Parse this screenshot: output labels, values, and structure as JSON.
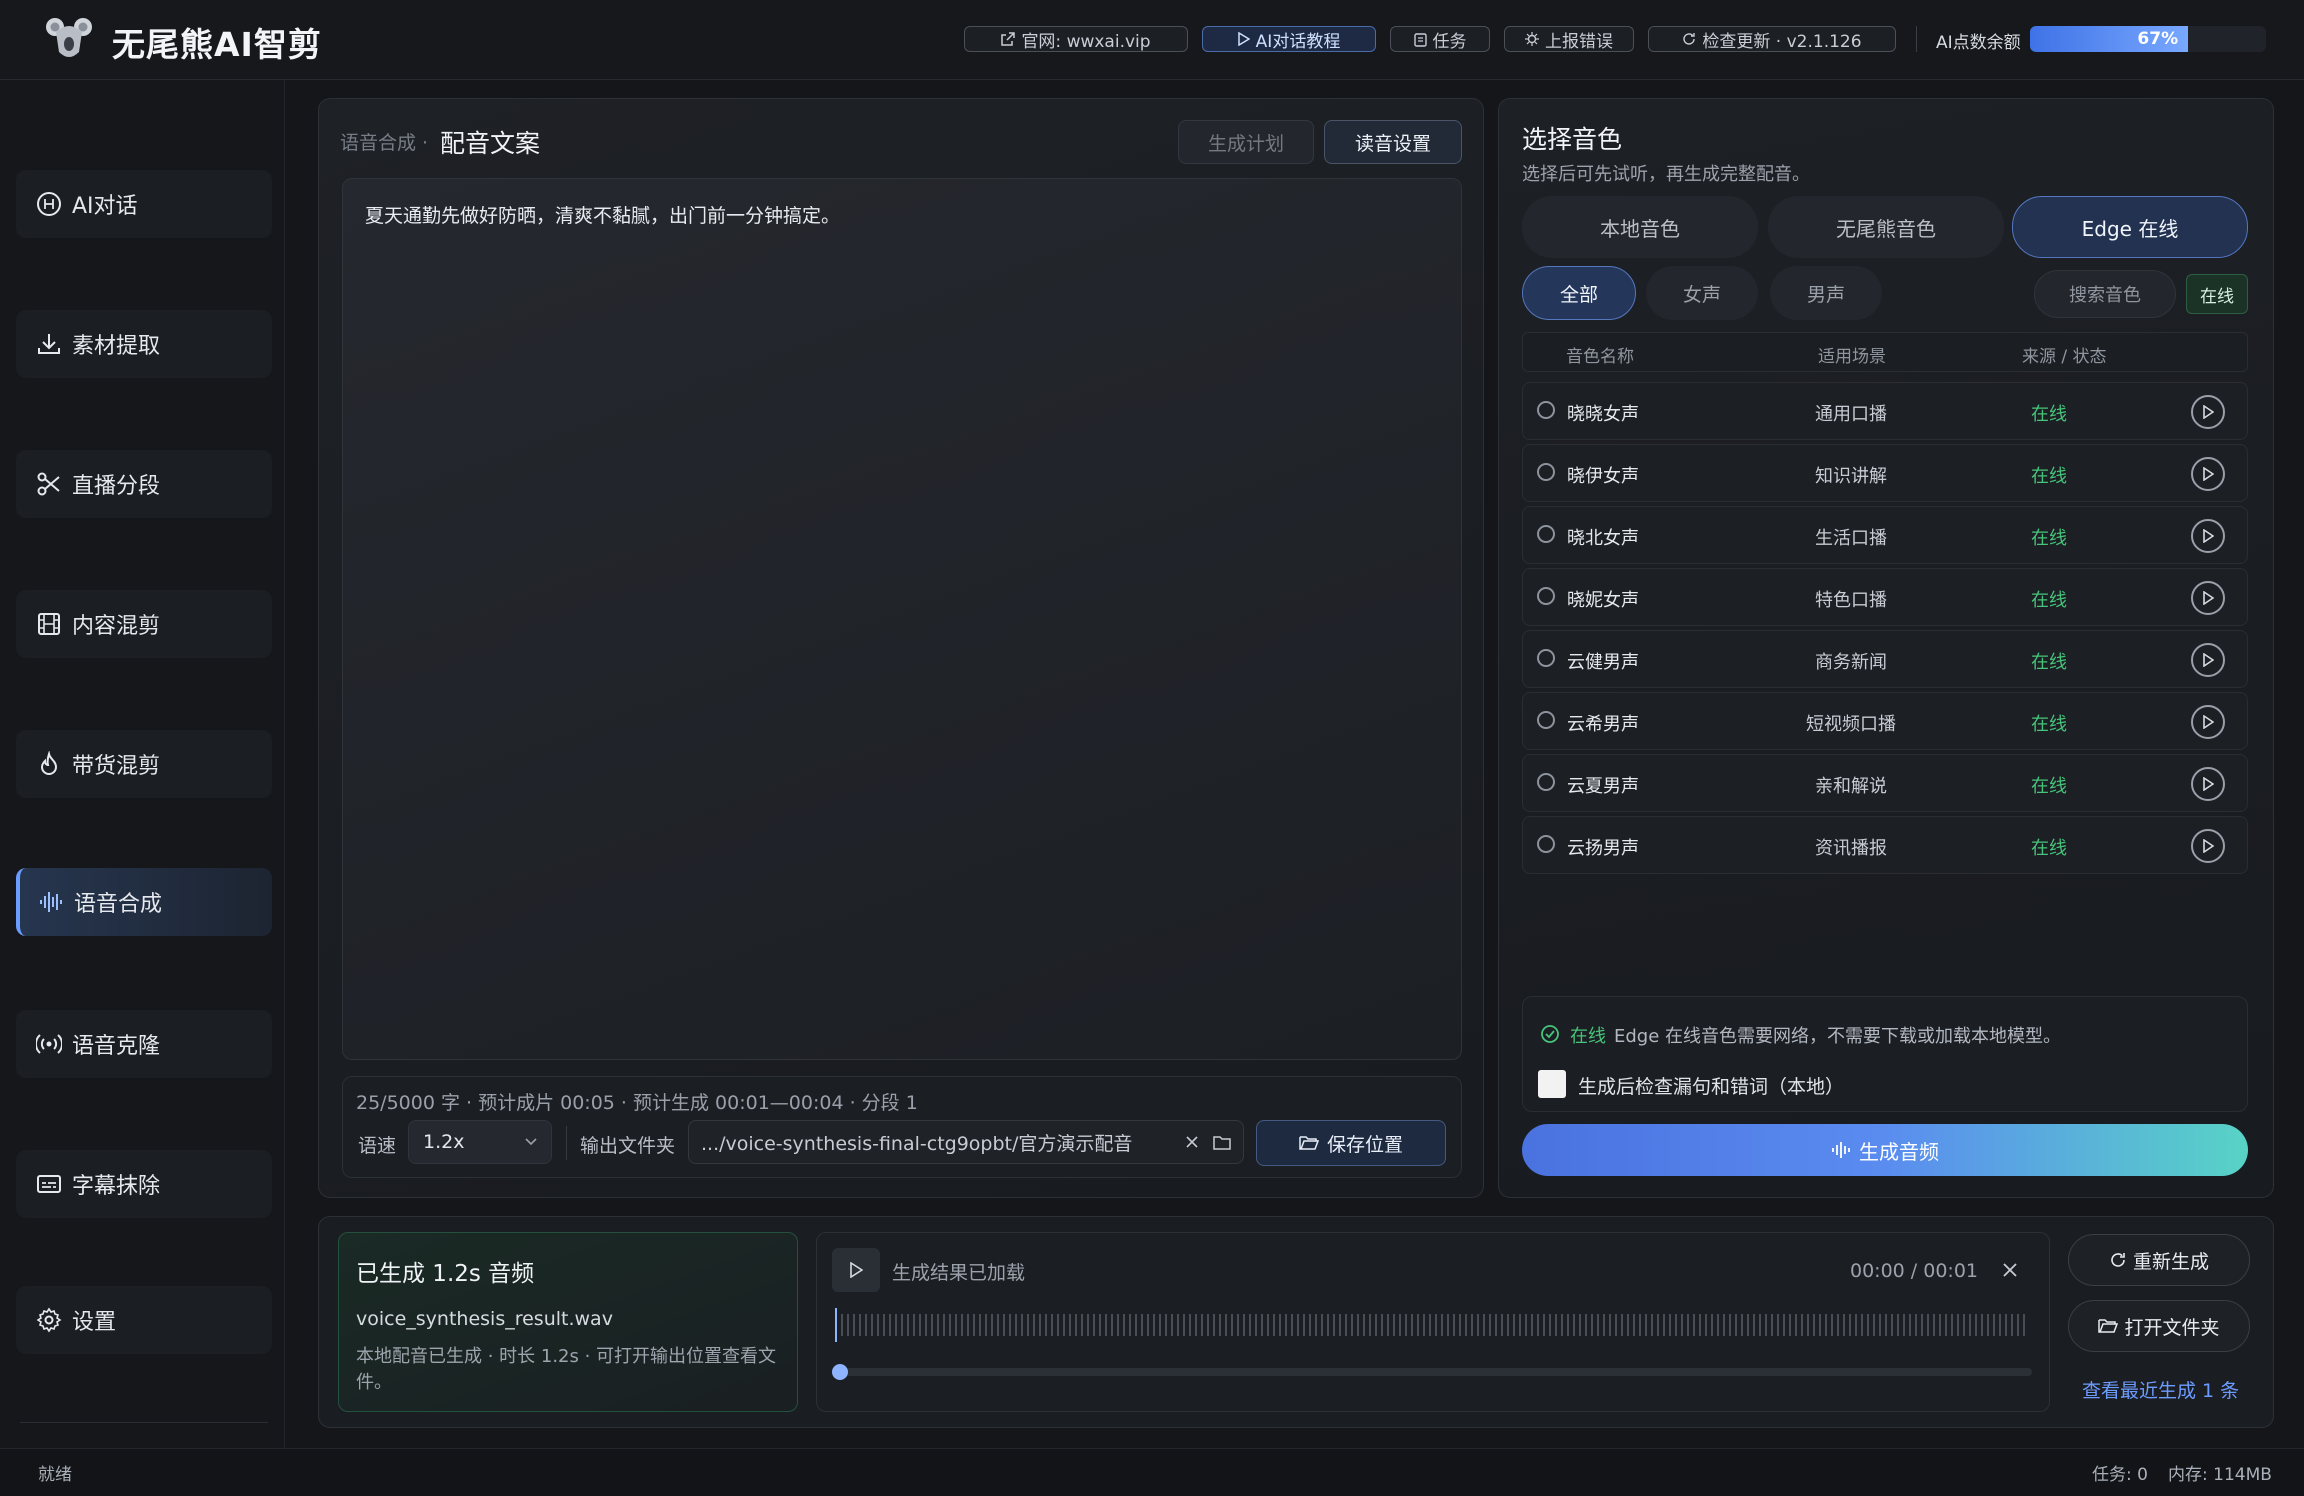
{
  "app": {
    "title": "无尾熊AI智剪"
  },
  "header": {
    "buttons": [
      {
        "label": "官网: wwxai.vip",
        "icon": "external-link-icon"
      },
      {
        "label": "AI对话教程",
        "icon": "play-icon"
      },
      {
        "label": "任务",
        "icon": "clipboard-icon"
      },
      {
        "label": "上报错误",
        "icon": "bug-icon"
      },
      {
        "label": "检查更新 · v2.1.126",
        "icon": "refresh-icon"
      }
    ],
    "quota_label": "AI点数余额",
    "quota_percent": 67,
    "quota_text": "67%"
  },
  "sidebar": {
    "items": [
      {
        "label": "AI对话",
        "icon": "ai-chat-icon"
      },
      {
        "label": "素材提取",
        "icon": "download-icon"
      },
      {
        "label": "直播分段",
        "icon": "scissors-icon"
      },
      {
        "label": "内容混剪",
        "icon": "film-icon"
      },
      {
        "label": "带货混剪",
        "icon": "flame-icon"
      },
      {
        "label": "语音合成",
        "icon": "waveform-icon"
      },
      {
        "label": "语音克隆",
        "icon": "broadcast-icon"
      },
      {
        "label": "字幕抹除",
        "icon": "subtitle-icon"
      },
      {
        "label": "设置",
        "icon": "gear-icon"
      }
    ],
    "active_index": 5
  },
  "editor": {
    "breadcrumb": "语音合成 ·",
    "title": "配音文案",
    "plan_button": "生成计划",
    "read_settings_button": "读音设置",
    "text": "夏天通勤先做好防晒，清爽不黏腻，出门前一分钟搞定。",
    "stats": "25/5000 字 · 预计成片 00:05 · 预计生成 00:01—00:04 · 分段 1",
    "speed_label": "语速",
    "speed_value": "1.2x",
    "output_label": "输出文件夹",
    "output_path": ".../voice-synthesis-final-ctg9opbt/官方演示配音",
    "save_location_button": "保存位置"
  },
  "voice": {
    "title": "选择音色",
    "subtitle": "选择后可先试听，再生成完整配音。",
    "source_tabs": [
      "本地音色",
      "无尾熊音色",
      "Edge 在线"
    ],
    "source_active": 2,
    "filter_tabs": [
      "全部",
      "女声",
      "男声"
    ],
    "filter_active": 0,
    "search_placeholder": "搜索音色",
    "online_tag": "在线",
    "columns": [
      "音色名称",
      "适用场景",
      "来源 / 状态"
    ],
    "rows": [
      {
        "name": "晓晓女声",
        "scene": "通用口播",
        "status": "在线"
      },
      {
        "name": "晓伊女声",
        "scene": "知识讲解",
        "status": "在线"
      },
      {
        "name": "晓北女声",
        "scene": "生活口播",
        "status": "在线"
      },
      {
        "name": "晓妮女声",
        "scene": "特色口播",
        "status": "在线"
      },
      {
        "name": "云健男声",
        "scene": "商务新闻",
        "status": "在线"
      },
      {
        "name": "云希男声",
        "scene": "短视频口播",
        "status": "在线"
      },
      {
        "name": "云夏男声",
        "scene": "亲和解说",
        "status": "在线"
      },
      {
        "name": "云扬男声",
        "scene": "资讯播报",
        "status": "在线"
      }
    ],
    "info_online": "在线",
    "info_text": "Edge 在线音色需要网络，不需要下载或加载本地模型。",
    "check_label": "生成后检查漏句和错词（本地）",
    "generate_button": "生成音频"
  },
  "result": {
    "title": "已生成 1.2s 音频",
    "file": "voice_synthesis_result.wav",
    "desc": "本地配音已生成 · 时长 1.2s · 可打开输出位置查看文件。",
    "player_status": "生成结果已加载",
    "player_time": "00:00 / 00:01",
    "regen_button": "重新生成",
    "open_folder_button": "打开文件夹",
    "recent_link": "查看最近生成 1 条"
  },
  "footer": {
    "status": "就绪",
    "tasks": "任务: 0",
    "memory": "内存: 114MB"
  },
  "colors": {
    "accent": "#5a8cf0",
    "online_green": "#46c47a",
    "link_blue": "#6d9cff"
  }
}
